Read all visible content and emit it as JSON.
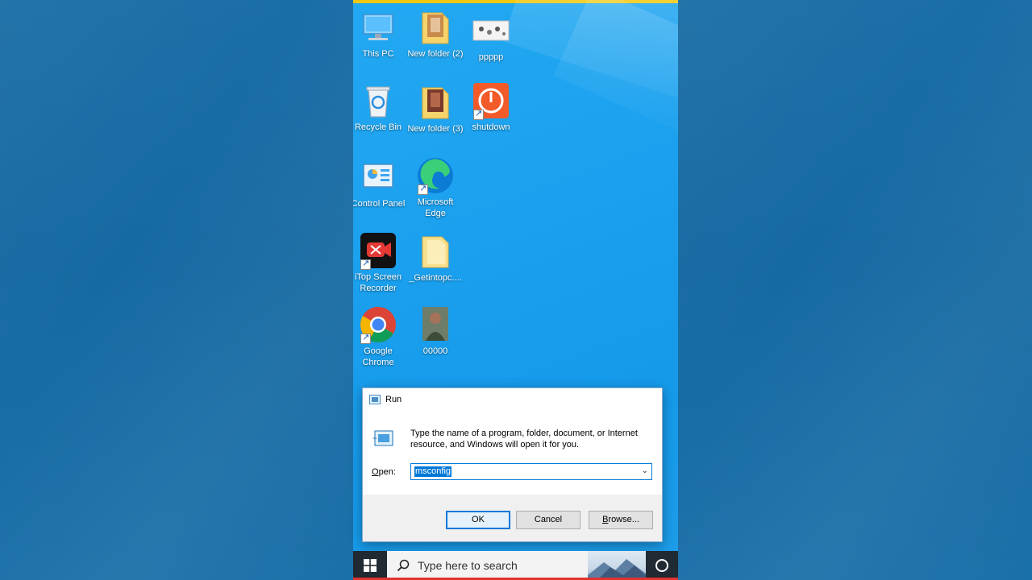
{
  "desktop": {
    "icons": [
      {
        "label": "This PC"
      },
      {
        "label": "New folder (2)"
      },
      {
        "label": "ppppp"
      },
      {
        "label": "Recycle Bin"
      },
      {
        "label": "New folder (3)"
      },
      {
        "label": "shutdown"
      },
      {
        "label": "Control Panel"
      },
      {
        "label": "Microsoft Edge"
      },
      {
        "label": "iTop Screen Recorder"
      },
      {
        "label": "_Getintopc...."
      },
      {
        "label": "Google Chrome"
      },
      {
        "label": "00000"
      }
    ]
  },
  "run_dialog": {
    "title": "Run",
    "description": "Type the name of a program, folder, document, or Internet resource, and Windows will open it for you.",
    "open_label_prefix": "O",
    "open_label_rest": "pen:",
    "open_value": "msconfig",
    "ok_label": "OK",
    "cancel_label": "Cancel",
    "browse_label_prefix": "B",
    "browse_label_rest": "rowse..."
  },
  "taskbar": {
    "search_placeholder": "Type here to search"
  },
  "colors": {
    "accent": "#0078d7",
    "desktop": "#1aa0ee",
    "taskbar": "#1f2a33",
    "frame": "#146aa1"
  }
}
